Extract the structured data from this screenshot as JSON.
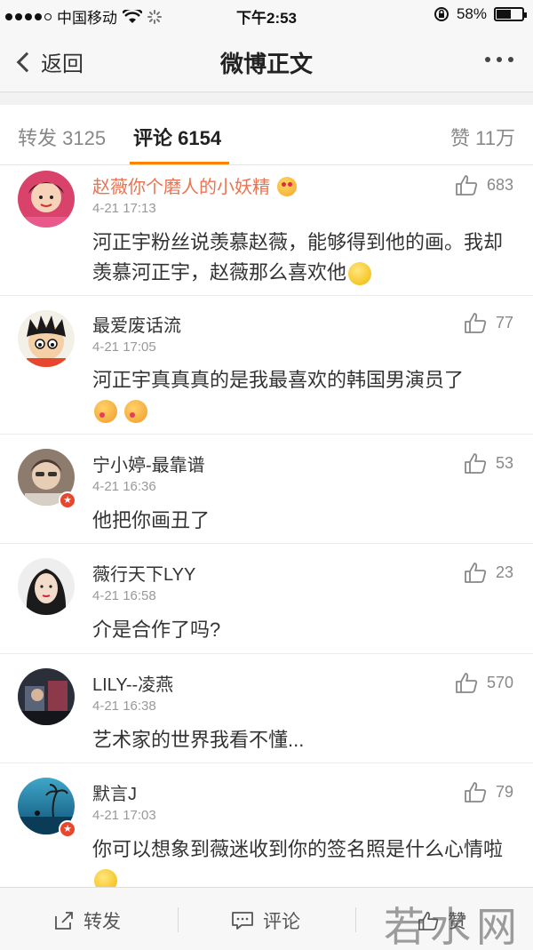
{
  "status_bar": {
    "carrier": "中国移动",
    "time": "下午2:53",
    "battery": "58%",
    "battery_level": 0.58
  },
  "nav": {
    "back_label": "返回",
    "title": "微博正文"
  },
  "tabs": {
    "repost": "转发 3125",
    "comment": "评论 6154",
    "like": "赞 11万"
  },
  "comments": [
    {
      "name": "赵薇你个磨人的小妖精",
      "time": "4-21 17:13",
      "text": "河正宇粉丝说羡慕赵薇，能够得到他的画。我却羡慕河正宇，赵薇那么喜欢他",
      "likes": "683"
    },
    {
      "name": "最爱废话流",
      "time": "4-21 17:05",
      "text": "河正宇真真真的是我最喜欢的韩国男演员了",
      "likes": "77"
    },
    {
      "name": "宁小婷-最靠谱",
      "time": "4-21 16:36",
      "text": "他把你画丑了",
      "likes": "53"
    },
    {
      "name": "薇行天下LYY",
      "time": "4-21 16:58",
      "text": "介是合作了吗?",
      "likes": "23"
    },
    {
      "name": "LILY--凌燕",
      "time": "4-21 16:38",
      "text": "艺术家的世界我看不懂...",
      "likes": "570"
    },
    {
      "name": "默言J",
      "time": "4-21 17:03",
      "text": "你可以想象到薇迷收到你的签名照是什么心情啦",
      "likes": "79"
    }
  ],
  "toolbar": {
    "repost": "转发",
    "comment": "评论",
    "like": "赞"
  },
  "watermark": "若水网",
  "colors": {
    "accent": "#ff8200",
    "vip_name": "#eb7350",
    "badge": "#e8462d"
  }
}
